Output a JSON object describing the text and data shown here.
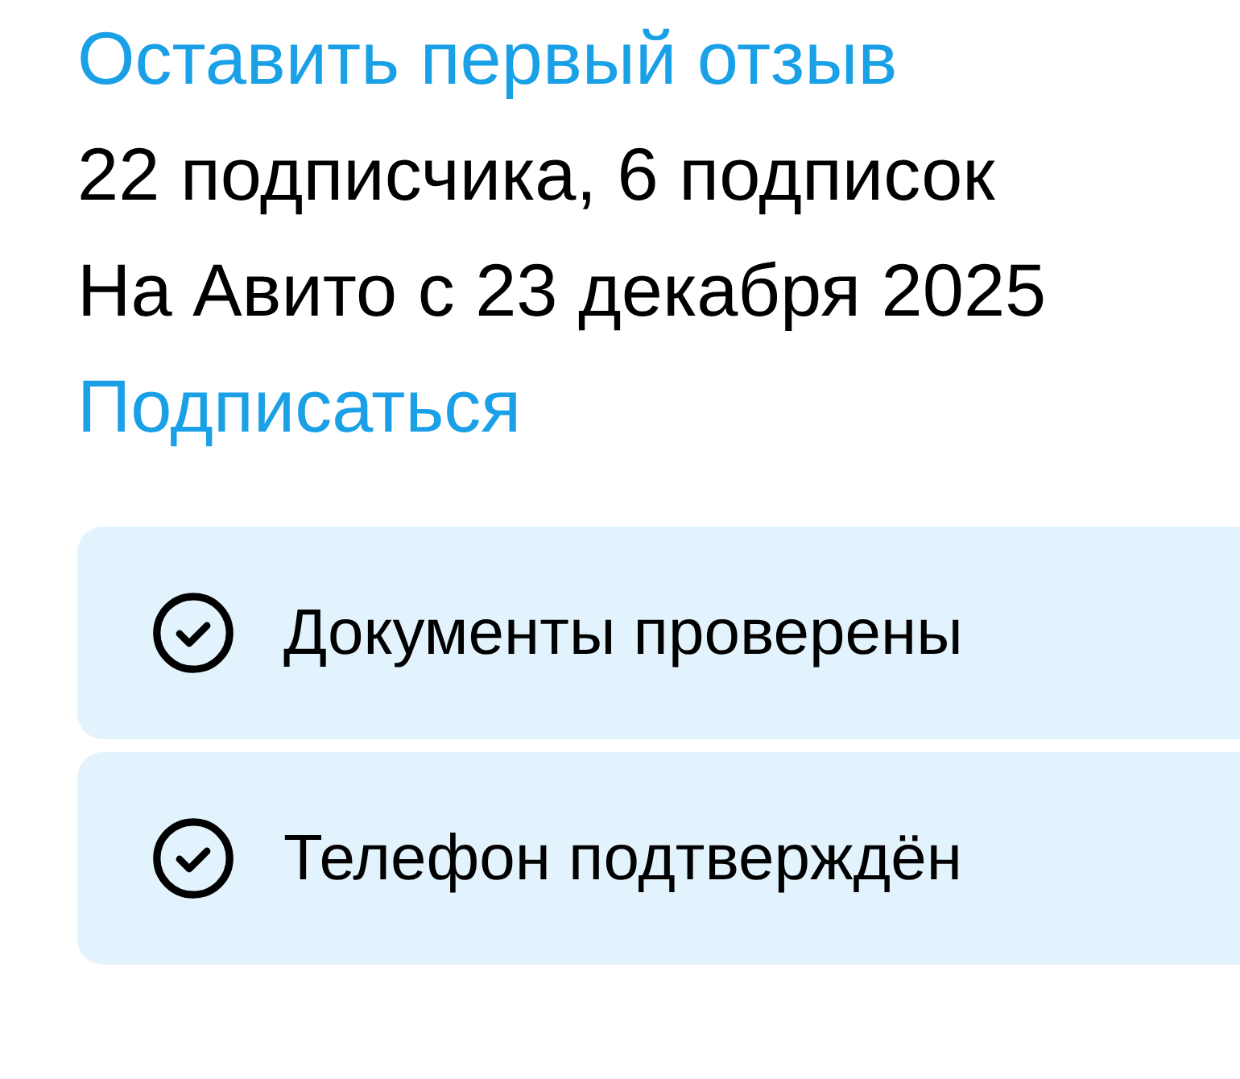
{
  "review_link": "Оставить первый отзыв",
  "stats": "22 подписчика, 6 подписок",
  "member_since": "На Авито с 23 декабря 2025",
  "subscribe_link": "Подписаться",
  "badges": [
    {
      "label": "Документы проверены"
    },
    {
      "label": "Телефон подтверждён"
    }
  ]
}
